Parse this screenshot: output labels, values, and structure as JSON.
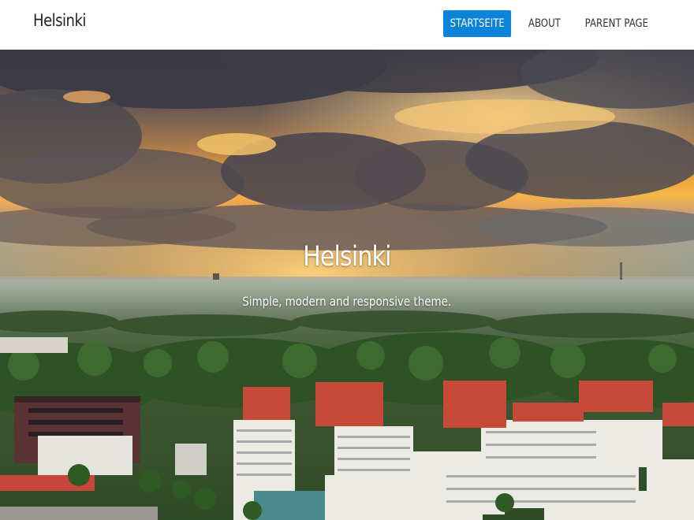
{
  "site": {
    "title": "Helsinki"
  },
  "nav": {
    "items": [
      {
        "label": "STARTSEITE",
        "active": true
      },
      {
        "label": "ABOUT",
        "active": false
      },
      {
        "label": "PARENT PAGE",
        "active": false
      }
    ]
  },
  "hero": {
    "title": "Helsinki",
    "subtitle": "Simple, modern and responsive theme.",
    "image_description": "sunset-over-city-photo"
  },
  "colors": {
    "accent": "#0b83d8",
    "header_background": "#ffffff",
    "text": "#222222"
  }
}
